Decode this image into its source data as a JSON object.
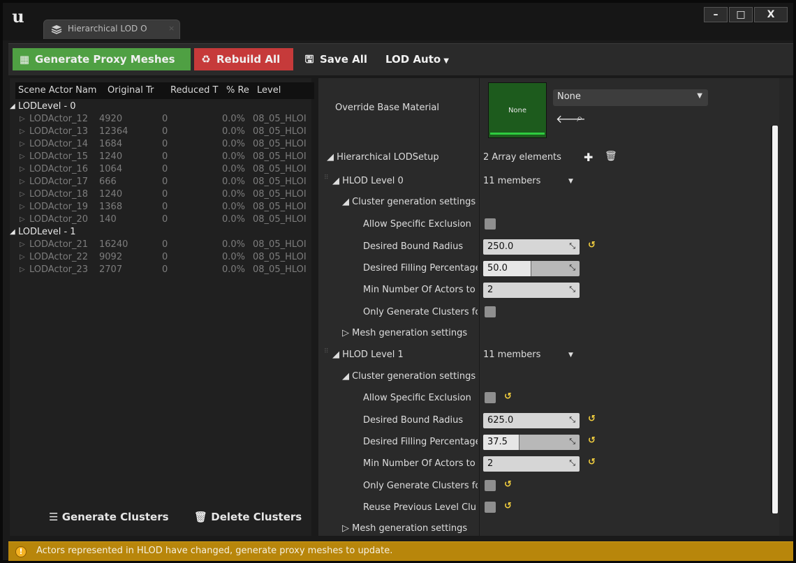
{
  "window": {
    "tab_label": "Hierarchical LOD O",
    "tab_close": "×",
    "logo": "u",
    "controls": {
      "minimize": "–",
      "maximize": "□",
      "close": "X"
    }
  },
  "toolbar": {
    "generate_proxy_label": "Generate Proxy Meshes",
    "rebuild_all_label": "Rebuild All",
    "save_all_label": "Save All",
    "lod_auto_label": "LOD Auto",
    "generate_color": "#4fa043",
    "rebuild_color": "#c63a3a"
  },
  "outliner": {
    "columns": [
      "Scene Actor Nam",
      "Original Tr",
      "Reduced T",
      "% Re",
      "Level"
    ],
    "groups": [
      {
        "label": "LODLevel - 0",
        "actors": [
          {
            "name": "LODActor_12",
            "orig": "4920",
            "reduced": "0",
            "pct": "0.0%",
            "level": "08_05_HLOI"
          },
          {
            "name": "LODActor_13",
            "orig": "12364",
            "reduced": "0",
            "pct": "0.0%",
            "level": "08_05_HLOI"
          },
          {
            "name": "LODActor_14",
            "orig": "1684",
            "reduced": "0",
            "pct": "0.0%",
            "level": "08_05_HLOI"
          },
          {
            "name": "LODActor_15",
            "orig": "1240",
            "reduced": "0",
            "pct": "0.0%",
            "level": "08_05_HLOI"
          },
          {
            "name": "LODActor_16",
            "orig": "1064",
            "reduced": "0",
            "pct": "0.0%",
            "level": "08_05_HLOI"
          },
          {
            "name": "LODActor_17",
            "orig": "666",
            "reduced": "0",
            "pct": "0.0%",
            "level": "08_05_HLOI"
          },
          {
            "name": "LODActor_18",
            "orig": "1240",
            "reduced": "0",
            "pct": "0.0%",
            "level": "08_05_HLOI"
          },
          {
            "name": "LODActor_19",
            "orig": "1368",
            "reduced": "0",
            "pct": "0.0%",
            "level": "08_05_HLOI"
          },
          {
            "name": "LODActor_20",
            "orig": "140",
            "reduced": "0",
            "pct": "0.0%",
            "level": "08_05_HLOI"
          }
        ]
      },
      {
        "label": "LODLevel - 1",
        "actors": [
          {
            "name": "LODActor_21",
            "orig": "16240",
            "reduced": "0",
            "pct": "0.0%",
            "level": "08_05_HLOI"
          },
          {
            "name": "LODActor_22",
            "orig": "9092",
            "reduced": "0",
            "pct": "0.0%",
            "level": "08_05_HLOI"
          },
          {
            "name": "LODActor_23",
            "orig": "2707",
            "reduced": "0",
            "pct": "0.0%",
            "level": "08_05_HLOI"
          }
        ]
      }
    ],
    "generate_clusters_label": "Generate Clusters",
    "delete_clusters_label": "Delete Clusters"
  },
  "details": {
    "override_material": {
      "label": "Override Base Material",
      "thumb_label": "None",
      "selected": "None"
    },
    "hlod_setup": {
      "label": "Hierarchical LODSetup",
      "value": "2 Array elements"
    },
    "levels": [
      {
        "label": "HLOD Level 0",
        "members": "11 members",
        "cluster_label": "Cluster generation settings",
        "allow_exclusion": "Allow Specific Exclusion",
        "bound_radius_label": "Desired Bound Radius",
        "bound_radius": "250.0",
        "filling_label": "Desired Filling Percentage",
        "filling": "50.0",
        "filling_fraction": 0.5,
        "min_actors_label": "Min Number Of Actors to",
        "min_actors": "2",
        "only_generate_label": "Only Generate Clusters fo",
        "mesh_label": "Mesh generation settings"
      },
      {
        "label": "HLOD Level 1",
        "members": "11 members",
        "cluster_label": "Cluster generation settings",
        "allow_exclusion": "Allow Specific Exclusion",
        "bound_radius_label": "Desired Bound Radius",
        "bound_radius": "625.0",
        "filling_label": "Desired Filling Percentage",
        "filling": "37.5",
        "filling_fraction": 0.375,
        "min_actors_label": "Min Number Of Actors to",
        "min_actors": "2",
        "only_generate_label": "Only Generate Clusters fo",
        "reuse_label": "Reuse Previous Level Clu",
        "mesh_label": "Mesh generation settings"
      }
    ]
  },
  "status": {
    "message": "Actors represented in HLOD have changed, generate proxy meshes to update.",
    "icon": "warning-icon",
    "color": "#b8860b"
  }
}
